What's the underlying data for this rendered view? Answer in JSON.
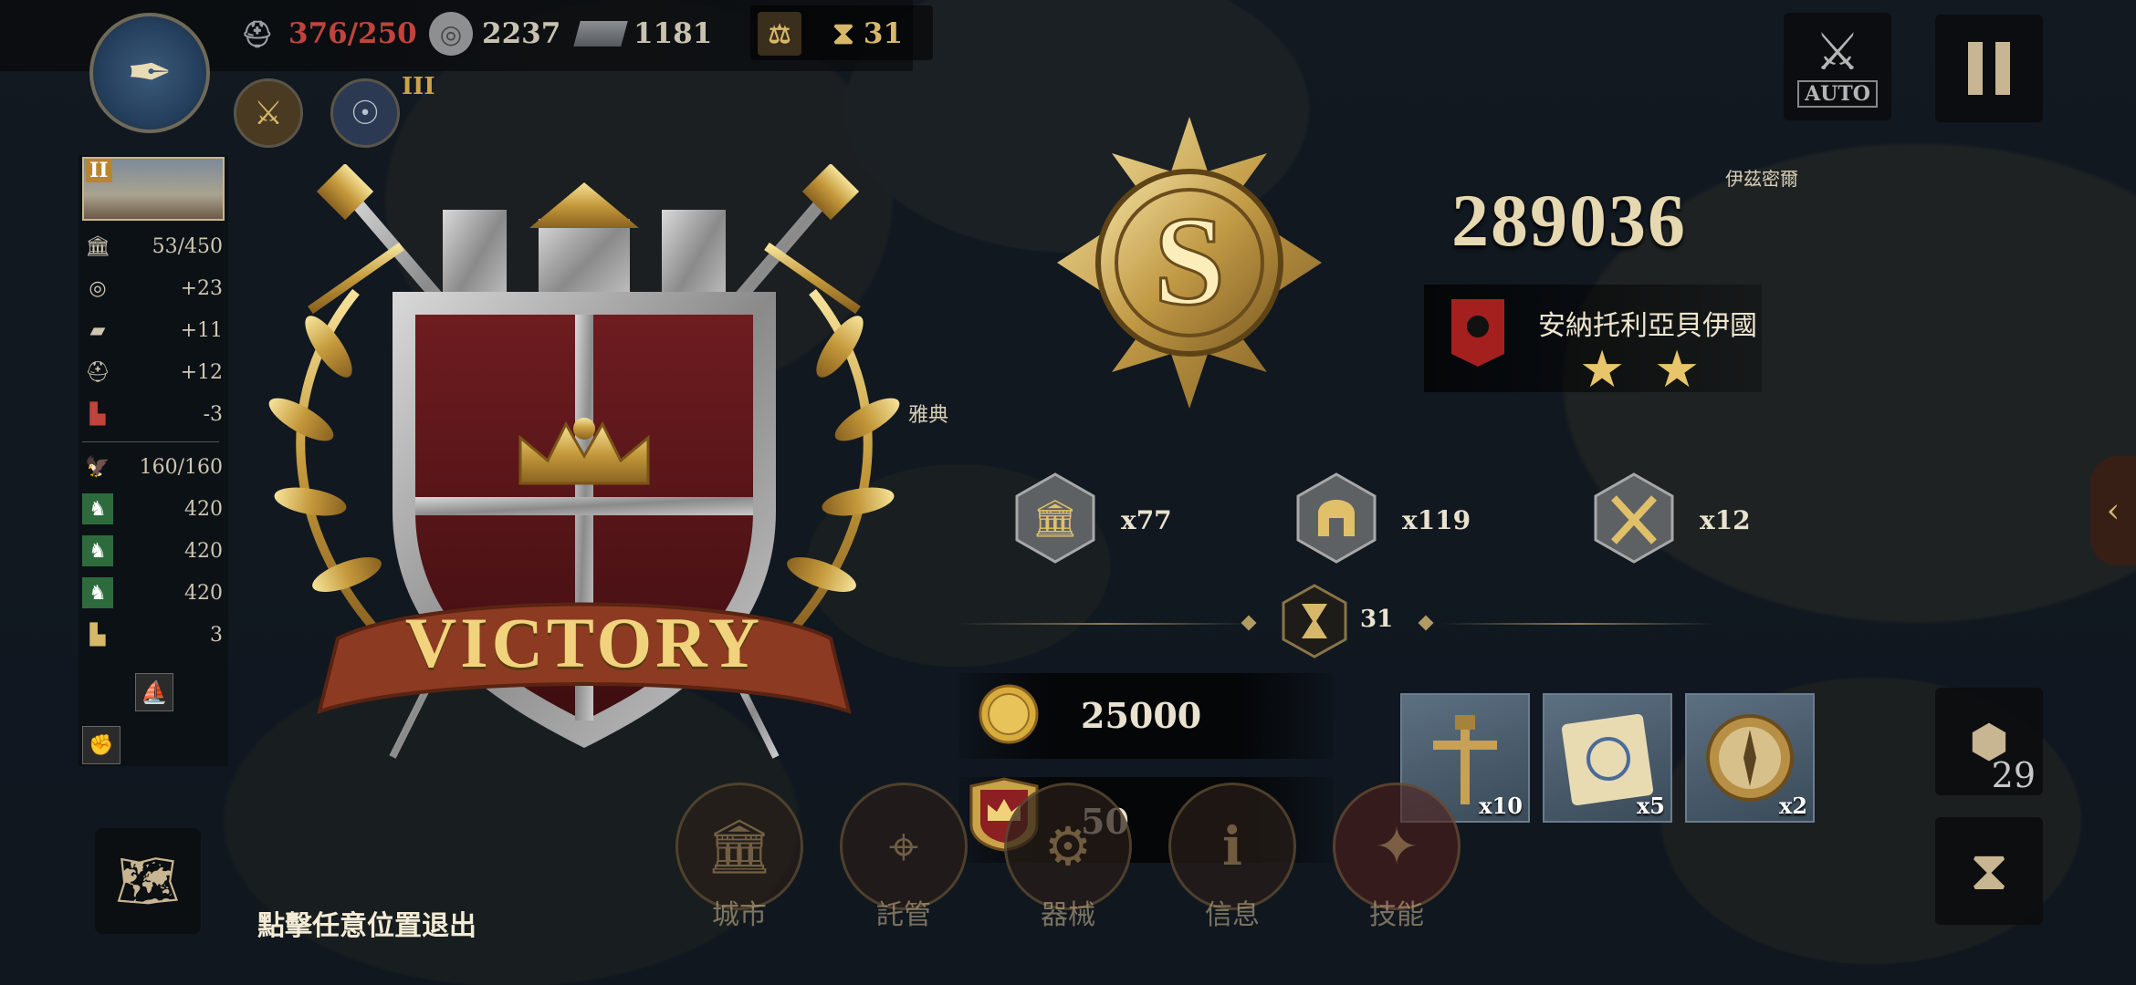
{
  "hud": {
    "troops": "376/250",
    "silver": "2237",
    "iron": "1181",
    "turns": "31",
    "roman_rank": "III",
    "roman_rank2": "II"
  },
  "sidebar": {
    "city_level": "II",
    "stats": [
      {
        "icon": "city-icon",
        "value": "53/450"
      },
      {
        "icon": "silver-icon",
        "value": "+23"
      },
      {
        "icon": "iron-icon",
        "value": "+11"
      },
      {
        "icon": "helmet-icon",
        "value": "+12"
      },
      {
        "icon": "boot-icon",
        "value": "-3"
      },
      {
        "icon": "eagle-icon",
        "value": "160/160"
      },
      {
        "icon": "cavalry-icon",
        "value": "420"
      },
      {
        "icon": "cavalry-icon",
        "value": "420"
      },
      {
        "icon": "cavalry-icon",
        "value": "420"
      },
      {
        "icon": "boot-icon",
        "value": "3"
      }
    ]
  },
  "result": {
    "title": "VICTORY",
    "grade": "S",
    "score": "289036",
    "nation": "安納托利亞貝伊國",
    "stars": 2,
    "stats": [
      {
        "icon": "city-icon",
        "value": "x77"
      },
      {
        "icon": "helmet-icon",
        "value": "x119"
      },
      {
        "icon": "crossed-swords-icon",
        "value": "x12"
      }
    ],
    "turns": "31",
    "gold": "25000",
    "medals": "50",
    "items": [
      {
        "icon": "cannon-tool-icon",
        "qty": "x10"
      },
      {
        "icon": "scroll-icon",
        "qty": "x5"
      },
      {
        "icon": "compass-icon",
        "qty": "x2"
      }
    ]
  },
  "bottom_nav": [
    {
      "label": "城市",
      "icon": "city-icon"
    },
    {
      "label": "託管",
      "icon": "map-pin-icon"
    },
    {
      "label": "器械",
      "icon": "siege-icon"
    },
    {
      "label": "信息",
      "icon": "info-icon"
    },
    {
      "label": "技能",
      "icon": "skill-icon"
    }
  ],
  "exit_hint": "點擊任意位置退出",
  "map_labels": {
    "athens": "雅典",
    "ismir": "伊茲密爾"
  },
  "controls": {
    "auto_label": "AUTO",
    "hex_count": "29"
  },
  "colors": {
    "gold": "#e8c56a",
    "dark_red": "#6e1c20",
    "bg": "#1d2630"
  }
}
